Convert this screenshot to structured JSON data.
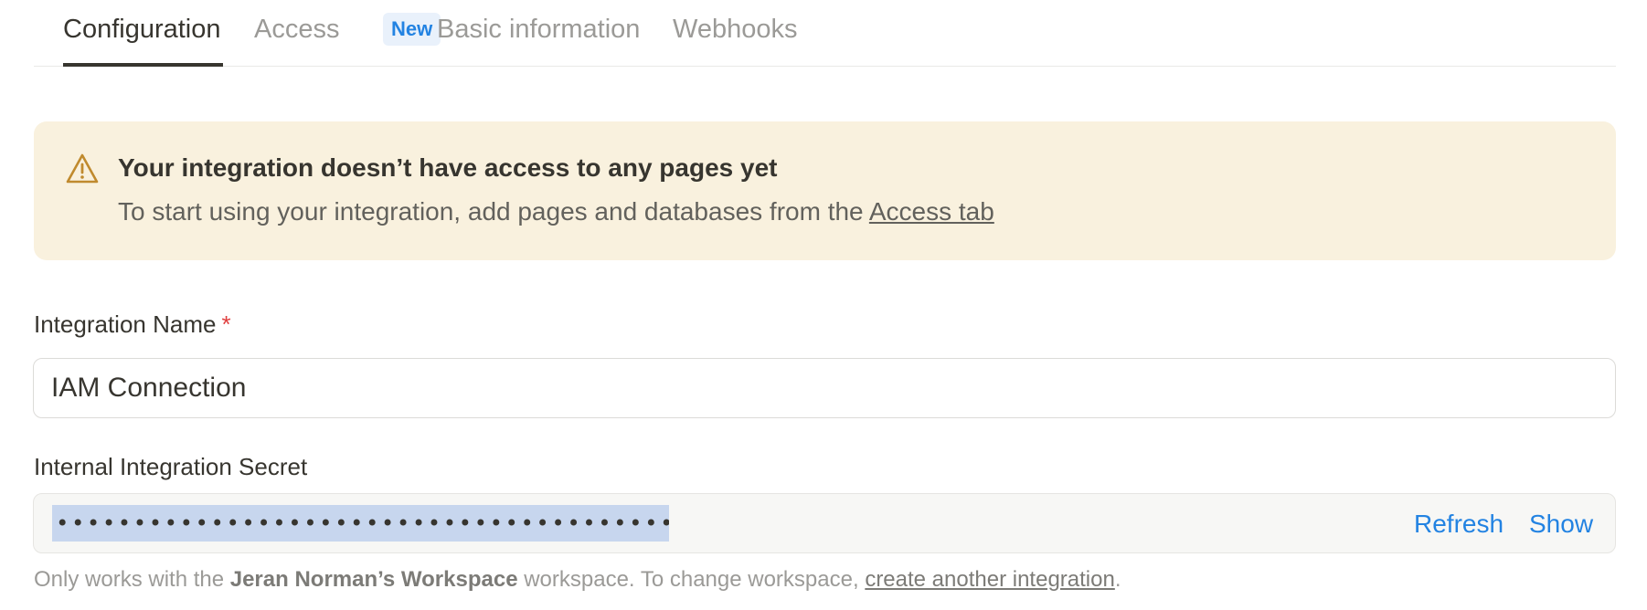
{
  "tabs": [
    {
      "label": "Configuration",
      "active": true
    },
    {
      "label": "Access",
      "badge": "New"
    },
    {
      "label": "Basic information"
    },
    {
      "label": "Webhooks"
    }
  ],
  "callout": {
    "icon": "warning-triangle-icon",
    "title": "Your integration doesn’t have access to any pages yet",
    "body": "To start using your integration, add pages and databases from the ",
    "link": "Access tab"
  },
  "integration_name": {
    "label": "Integration Name",
    "required_mark": "*",
    "value": "IAM Connection"
  },
  "secret": {
    "label": "Internal Integration Secret",
    "masked_value": "••••••••••••••••••••••••••••••••••••••••••••••",
    "refresh_label": "Refresh",
    "show_label": "Show"
  },
  "footnote": {
    "prefix": "Only works with the ",
    "workspace": "Jeran Norman’s Workspace",
    "middle": " workspace. To change workspace, ",
    "link": "create another integration",
    "suffix": "."
  },
  "colors": {
    "accent": "#2383e2",
    "callout_bg": "#f9f1de",
    "warning_icon": "#c08a2e",
    "required": "#e03e3e",
    "selection": "#c7d6ee"
  }
}
